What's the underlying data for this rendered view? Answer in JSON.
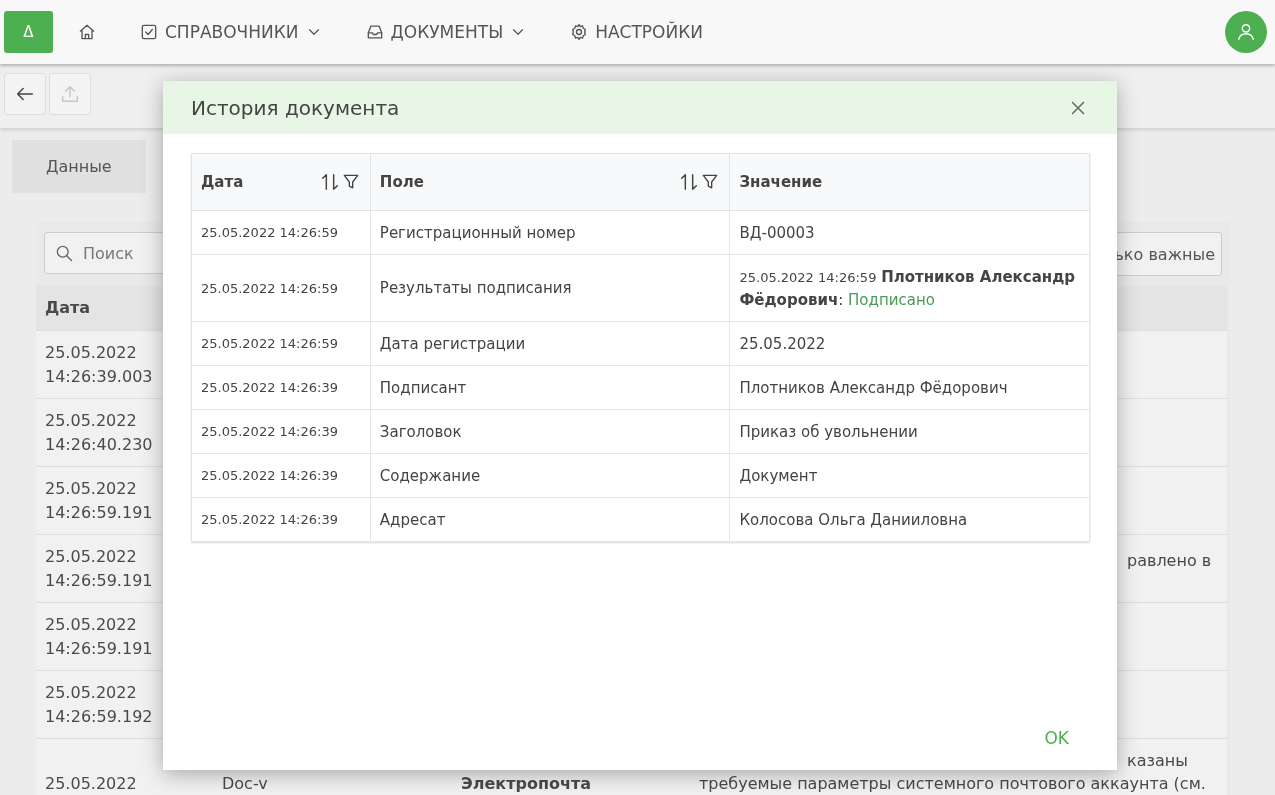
{
  "nav": {
    "logo": "Δ",
    "items": [
      {
        "kind": "home"
      },
      {
        "kind": "menu",
        "label": "СПРАВОЧНИКИ",
        "dropdown": true
      },
      {
        "kind": "menu",
        "label": "ДОКУМЕНТЫ",
        "dropdown": true
      },
      {
        "kind": "menu",
        "label": "НАСТРОЙКИ",
        "dropdown": false
      }
    ]
  },
  "toolbar": [
    {
      "disabled": false
    },
    {
      "disabled": true
    }
  ],
  "background": {
    "tabs": [
      {
        "label": "Данные",
        "selected": true
      }
    ],
    "search": {
      "placeholder": "Поиск"
    },
    "filter_button": "ько важные",
    "table": {
      "columns": [
        "Дата"
      ],
      "rows": [
        {
          "date": "25.05.2022",
          "time": "14:26:39.003"
        },
        {
          "date": "25.05.2022",
          "time": "14:26:40.230"
        },
        {
          "date": "25.05.2022",
          "time": "14:26:59.191"
        },
        {
          "date": "25.05.2022",
          "time": "14:26:59.191",
          "right_text": "равлено в"
        },
        {
          "date": "25.05.2022",
          "time": "14:26:59.191"
        },
        {
          "date": "25.05.2022",
          "time": "14:26:59.192"
        },
        {
          "date": "25.05.2022",
          "cells": [
            "Doc-v",
            "Электропочта"
          ],
          "right_text": "казаны",
          "description": "требуемые параметры системного почтового аккаунта (см."
        }
      ]
    }
  },
  "dialog": {
    "title": "История документа",
    "columns": [
      {
        "label": "Дата",
        "sortable": true,
        "filterable": true
      },
      {
        "label": "Поле",
        "sortable": true,
        "filterable": true
      },
      {
        "label": "Значение",
        "sortable": false,
        "filterable": false
      }
    ],
    "rows": [
      {
        "date": "25.05.2022 14:26:59",
        "field": "Регистрационный номер",
        "value": {
          "kind": "text",
          "text": "ВД-00003"
        }
      },
      {
        "date": "25.05.2022 14:26:59",
        "field": "Результаты подписания",
        "value": {
          "kind": "signature",
          "date": "25.05.2022 14:26:59",
          "signer": "Плотников Александр Фёдорович",
          "separator": ":",
          "status": "Подписано"
        }
      },
      {
        "date": "25.05.2022 14:26:59",
        "field": "Дата регистрации",
        "value": {
          "kind": "text",
          "text": "25.05.2022"
        }
      },
      {
        "date": "25.05.2022 14:26:39",
        "field": "Подписант",
        "value": {
          "kind": "text",
          "text": "Плотников Александр Фёдорович"
        }
      },
      {
        "date": "25.05.2022 14:26:39",
        "field": "Заголовок",
        "value": {
          "kind": "text",
          "text": "Приказ об увольнении"
        }
      },
      {
        "date": "25.05.2022 14:26:39",
        "field": "Содержание",
        "value": {
          "kind": "text",
          "text": "Документ"
        }
      },
      {
        "date": "25.05.2022 14:26:39",
        "field": "Адресат",
        "value": {
          "kind": "text",
          "text": "Колосова Ольга Данииловна"
        }
      }
    ],
    "ok_button": "OK"
  }
}
